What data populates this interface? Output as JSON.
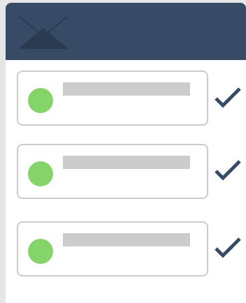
{
  "colors": {
    "header": "#374b66",
    "background": "#e6e6e6",
    "card_border": "#cccccc",
    "status_dot": "#85d46a",
    "checkmark": "#374b66",
    "placeholder": "#cccccc"
  },
  "header": {
    "icon": "envelope-icon"
  },
  "items": [
    {
      "status_icon": "green-dot",
      "action_icon": "checkmark-icon"
    },
    {
      "status_icon": "green-dot",
      "action_icon": "checkmark-icon"
    },
    {
      "status_icon": "green-dot",
      "action_icon": "checkmark-icon"
    }
  ]
}
